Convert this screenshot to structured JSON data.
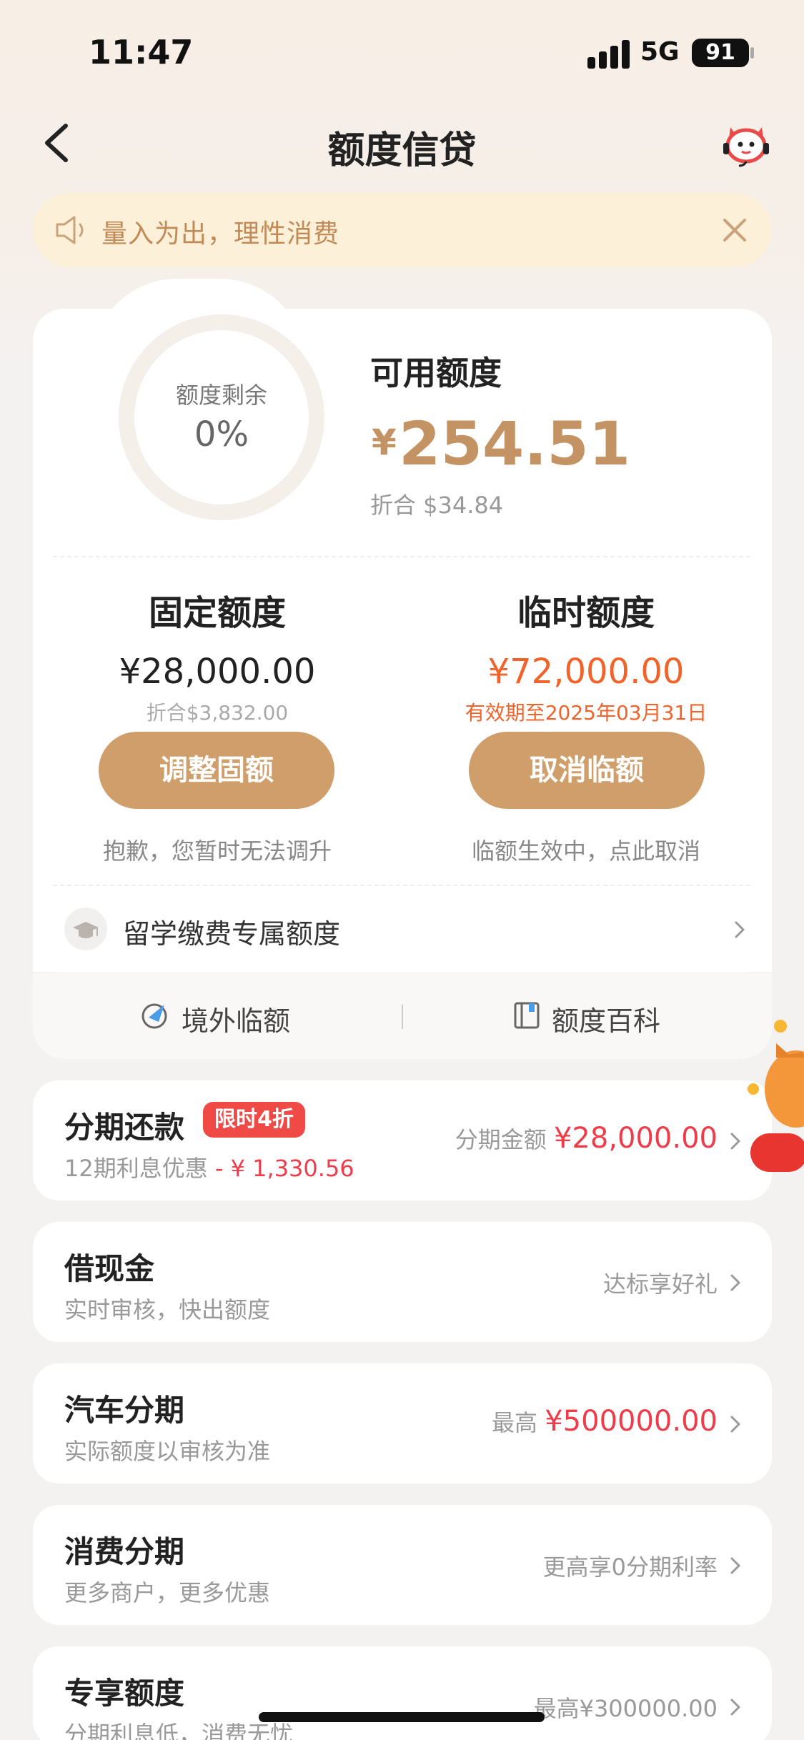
{
  "status_bar": {
    "time": "11:47",
    "network": "5G",
    "battery": "91"
  },
  "nav": {
    "title": "额度信贷",
    "back_icon": "chevron-left-icon",
    "assistant_icon": "mascot-icon"
  },
  "notice": {
    "text": "量入为出，理性消费",
    "icon": "speaker-icon",
    "close_icon": "close-icon"
  },
  "credit": {
    "ring_label": "额度剩余",
    "ring_value": "0%",
    "available_label": "可用额度",
    "currency": "¥",
    "available_amount": "254.51",
    "available_converted": "折合  $34.84"
  },
  "fixed": {
    "title": "固定额度",
    "amount": "¥28,000.00",
    "converted": "折合$3,832.00",
    "button": "调整固额",
    "hint": "抱歉，您暂时无法调升"
  },
  "temp": {
    "title": "临时额度",
    "amount": "¥72,000.00",
    "validity": "有效期至2025年03月31日",
    "button": "取消临额",
    "hint": "临额生效中，点此取消"
  },
  "study": {
    "label": "留学缴费专属额度",
    "icon": "graduation-cap-icon"
  },
  "tools": [
    {
      "label": "境外临额",
      "icon": "plane-globe-icon"
    },
    {
      "label": "额度百科",
      "icon": "book-icon"
    }
  ],
  "products": [
    {
      "title": "分期还款",
      "badge": "限时4折",
      "sub_prefix": "12期利息优惠",
      "sub_highlight": " - ¥ 1,330.56",
      "right_label": "分期金额 ",
      "right_value": "¥28,000.00"
    },
    {
      "title": "借现金",
      "sub": "实时审核，快出额度",
      "right_label": "达标享好礼",
      "right_value": ""
    },
    {
      "title": "汽车分期",
      "sub": "实际额度以审核为准",
      "right_label": "最高 ",
      "right_value": "¥500000.00"
    },
    {
      "title": "消费分期",
      "sub": "更多商户，更多优惠",
      "right_label": "更高享0分期利率",
      "right_value": ""
    },
    {
      "title": "专享额度",
      "sub": "分期利息低，消费无忧",
      "right_label": "最高¥300000.00",
      "right_value": ""
    }
  ],
  "colors": {
    "accent_gold": "#cf9e6a",
    "amount_gold": "#c49364",
    "alert_orange": "#f0642c",
    "price_red": "#ee3c4a"
  }
}
